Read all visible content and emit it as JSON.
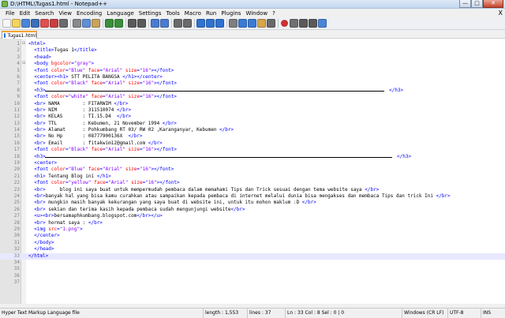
{
  "window": {
    "title": "D:\\HTML\\Tugas1.html - Notepad++",
    "minimize": "—",
    "maximize": "□",
    "close": "✕"
  },
  "menubar": {
    "items": [
      "File",
      "Edit",
      "Search",
      "View",
      "Encoding",
      "Language",
      "Settings",
      "Tools",
      "Macro",
      "Run",
      "Plugins",
      "Window",
      "?"
    ],
    "close_x": "X"
  },
  "toolbar": {
    "icons": [
      "new-file-icon",
      "open-file-icon",
      "save-icon",
      "save-all-icon",
      "close-icon",
      "close-all-icon",
      "print-icon",
      "sep",
      "cut-icon",
      "copy-icon",
      "paste-icon",
      "sep",
      "undo-icon",
      "redo-icon",
      "sep",
      "find-icon",
      "replace-icon",
      "sep",
      "zoom-in-icon",
      "zoom-out-icon",
      "sep",
      "sync-v-icon",
      "sync-h-icon",
      "sep",
      "wrap-icon",
      "all-chars-icon",
      "indent-guide-icon",
      "sep",
      "udl-icon",
      "doc-map-icon",
      "function-list-icon",
      "folder-workspace-icon",
      "monitor-icon",
      "sep",
      "record-macro-icon",
      "stop-macro-icon",
      "play-macro-icon",
      "run-macro-multiple-icon",
      "save-macro-icon"
    ]
  },
  "tab": {
    "label": "Tugas1.html",
    "close": "x"
  },
  "editor": {
    "lines": [
      {
        "n": "1",
        "fold": "⊟",
        "html": "<span class='tag'>&lt;html&gt;</span>"
      },
      {
        "n": "2",
        "fold": "",
        "html": "  <span class='tag'>&lt;title&gt;</span><span class='txt'>Tugas 1</span><span class='tag'>&lt;/title&gt;</span>"
      },
      {
        "n": "3",
        "fold": "",
        "html": "  <span class='tag'>&lt;head&gt;</span>"
      },
      {
        "n": "4",
        "fold": "⊟",
        "html": "  <span class='tag'>&lt;body </span><span class='attr'>bgcolor</span><span class='tag'>=</span><span class='val'>\"gray\"</span><span class='tag'>&gt;</span>"
      },
      {
        "n": "5",
        "fold": "",
        "html": "  <span class='tag'>&lt;font </span><span class='attr'>color</span><span class='tag'>=</span><span class='val'>\"Blue\"</span> <span class='attr'>face</span><span class='tag'>=</span><span class='val'>\"Arial\"</span> <span class='attr'>size</span><span class='tag'>=</span><span class='val'>\"16\"</span><span class='tag'>&gt;&lt;/font&gt;</span>"
      },
      {
        "n": "6",
        "fold": "",
        "html": "  <span class='tag'>&lt;center&gt;&lt;h1&gt;</span><span class='txt'> STT PELITA BANGSA </span><span class='tag'>&lt;/h1&gt;&lt;/center&gt;</span>"
      },
      {
        "n": "7",
        "fold": "",
        "html": "  <span class='tag'>&lt;font </span><span class='attr'>color</span><span class='tag'>=</span><span class='val'>\"Black\"</span> <span class='attr'>face</span><span class='tag'>=</span><span class='val'>\"Arial\"</span> <span class='attr'>size</span><span class='tag'>=</span><span class='val'>\"16\"</span><span class='tag'>&gt;&lt;/font&gt;</span>"
      },
      {
        "n": "8",
        "fold": "",
        "html": "  <span class='tag'>&lt;h3&gt;</span>",
        "hr": 430,
        "tail": "<span class='tag'>&lt;/h3&gt;</span>",
        "tailLeft": 493
      },
      {
        "n": "9",
        "fold": "",
        "html": "  <span class='tag'>&lt;font </span><span class='attr'>color</span><span class='tag'>=</span><span class='val'>\"white\"</span> <span class='attr'>face</span><span class='tag'>=</span><span class='val'>\"Arial\"</span> <span class='attr'>size</span><span class='tag'>=</span><span class='val'>\"16\"</span><span class='tag'>&gt;&lt;/font&gt;</span>"
      },
      {
        "n": "10",
        "fold": "",
        "html": "  <span class='tag'>&lt;br&gt;</span><span class='txt'> NAMA        : FITARWIM </span><span class='tag'>&lt;/br&gt;</span>"
      },
      {
        "n": "11",
        "fold": "",
        "html": "  <span class='tag'>&lt;br&gt;</span><span class='txt'> NIM         : 311510074 </span><span class='tag'>&lt;/br&gt;</span>"
      },
      {
        "n": "12",
        "fold": "",
        "html": "  <span class='tag'>&lt;br&gt;</span><span class='txt'> KELAS       : TI.15.D4  </span><span class='tag'>&lt;/br&gt;</span>"
      },
      {
        "n": "13",
        "fold": "",
        "html": "  <span class='tag'>&lt;br&gt;</span><span class='txt'> TTL         : Kebumen, 21 November 1994 </span><span class='tag'>&lt;/br&gt;</span>"
      },
      {
        "n": "14",
        "fold": "",
        "html": "  <span class='tag'>&lt;br&gt;</span><span class='txt'> Alamat      : Pohkumbang RT 03/ RW 02 ,Karanganyar, Kebumen </span><span class='tag'>&lt;/br&gt;</span>"
      },
      {
        "n": "15",
        "fold": "",
        "html": "  <span class='tag'>&lt;br&gt;</span><span class='txt'> No Hp       : 08777900136X  </span><span class='tag'>&lt;/br&gt;</span>"
      },
      {
        "n": "16",
        "fold": "",
        "html": "  <span class='tag'>&lt;br&gt;</span><span class='txt'> Email       : fitakwim12@gmail.com </span><span class='tag'>&lt;/br&gt;</span>"
      },
      {
        "n": "17",
        "fold": "",
        "html": "  <span class='tag'>&lt;font </span><span class='attr'>color</span><span class='tag'>=</span><span class='val'>\"Black\"</span> <span class='attr'>face</span><span class='tag'>=</span><span class='val'>\"Arial\"</span> <span class='attr'>size</span><span class='tag'>=</span><span class='val'>\"16\"</span><span class='tag'>&gt;&lt;/font&gt;</span>"
      },
      {
        "n": "18",
        "fold": "",
        "html": "  <span class='tag'>&lt;h3&gt;</span>",
        "hr": 440,
        "tail": "<span class='tag'>&lt;/h3&gt;</span>",
        "tailLeft": 503
      },
      {
        "n": "19",
        "fold": "",
        "html": "  <span class='tag'>&lt;center&gt;</span>"
      },
      {
        "n": "20",
        "fold": "",
        "html": "  <span class='tag'>&lt;font </span><span class='attr'>color</span><span class='tag'>=</span><span class='val'>\"Blue\"</span> <span class='attr'>face</span><span class='tag'>=</span><span class='val'>\"Arial\"</span> <span class='attr'>size</span><span class='tag'>=</span><span class='val'>\"16\"</span><span class='tag'>&gt;&lt;/font&gt;</span>"
      },
      {
        "n": "21",
        "fold": "",
        "html": "  <span class='tag'>&lt;h1&gt;</span><span class='txt'> Tentang Blog ini </span><span class='tag'>&lt;/h1&gt;</span>"
      },
      {
        "n": "22",
        "fold": "",
        "html": "  <span class='tag'>&lt;font </span><span class='attr'>color</span><span class='tag'>=</span><span class='val'>\"yellow\"</span> <span class='attr'>face</span><span class='tag'>=</span><span class='val'>\"Arial\"</span> <span class='attr'>size</span><span class='tag'>=</span><span class='val'>\"16\"</span><span class='tag'>&gt;&lt;/font&gt;</span>"
      },
      {
        "n": "23",
        "fold": "",
        "html": "  <span class='tag'>&lt;br&gt;</span><span class='txt'>     blog ini saya buat untuk mempermudah pembaca dalam memahami Tips dan Trick sesuai dengan tema website saya </span><span class='tag'>&lt;/br&gt;</span>"
      },
      {
        "n": "24",
        "fold": "",
        "html": "  <span class='tag'>&lt;br&gt;</span><span class='txt'>banyak hal yang bisa kamu curahkan atau sampaikan kepada pembaca di internet melalui dunia bisa mengakses dan membaca Tips dan trick Ini </span><span class='tag'>&lt;/br&gt;</span>"
      },
      {
        "n": "25",
        "fold": "",
        "html": "  <span class='tag'>&lt;br&gt;</span><span class='txt'> mungkin masih banyak kekurangan yang saya buat di website ini, untuk itu mohon maklum :D </span><span class='tag'>&lt;/br&gt;</span>"
      },
      {
        "n": "26",
        "fold": "",
        "html": "  <span class='tag'>&lt;br&gt;</span><span class='txt'> sekian dan terima kasih kepada pembaca sudah mengunjungi website</span><span class='tag'>&lt;/br&gt;</span>"
      },
      {
        "n": "27",
        "fold": "",
        "html": "  <span class='tag'>&lt;u&gt;&lt;br&gt;</span><span class='txt'>bersamaphkumbang.blogspot.com</span><span class='tag'>&lt;/br&gt;&lt;/u&gt;</span>"
      },
      {
        "n": "28",
        "fold": "",
        "html": "  <span class='tag'>&lt;br&gt;</span><span class='txt'> hormat saya : </span><span class='tag'>&lt;/br&gt;</span>"
      },
      {
        "n": "29",
        "fold": "",
        "html": "  <span class='tag'>&lt;img </span><span class='attr'>src</span><span class='tag'>=</span><span class='val'>\"1.png\"</span><span class='tag'>&gt;</span>"
      },
      {
        "n": "30",
        "fold": "",
        "html": "  <span class='tag'>&lt;/center&gt;</span>"
      },
      {
        "n": "31",
        "fold": "",
        "html": "  <span class='tag'>&lt;/body&gt;</span>"
      },
      {
        "n": "32",
        "fold": "",
        "html": "  <span class='tag'>&lt;/head&gt;</span>"
      },
      {
        "n": "33",
        "fold": "",
        "html": "<span class='tag'>&lt;/html&gt;</span>",
        "current": true
      },
      {
        "n": "34",
        "fold": "",
        "html": ""
      },
      {
        "n": "35",
        "fold": "",
        "html": ""
      },
      {
        "n": "36",
        "fold": "",
        "html": ""
      },
      {
        "n": "37",
        "fold": "",
        "html": ""
      }
    ]
  },
  "statusbar": {
    "filetype": "Hyper Text Markup Language file",
    "length": "length : 1,553",
    "lines": "lines : 37",
    "position": "Ln : 33   Col : 8   Sel : 0 | 0",
    "eol": "Windows (CR LF)",
    "encoding": "UTF-8",
    "mode": "INS"
  }
}
